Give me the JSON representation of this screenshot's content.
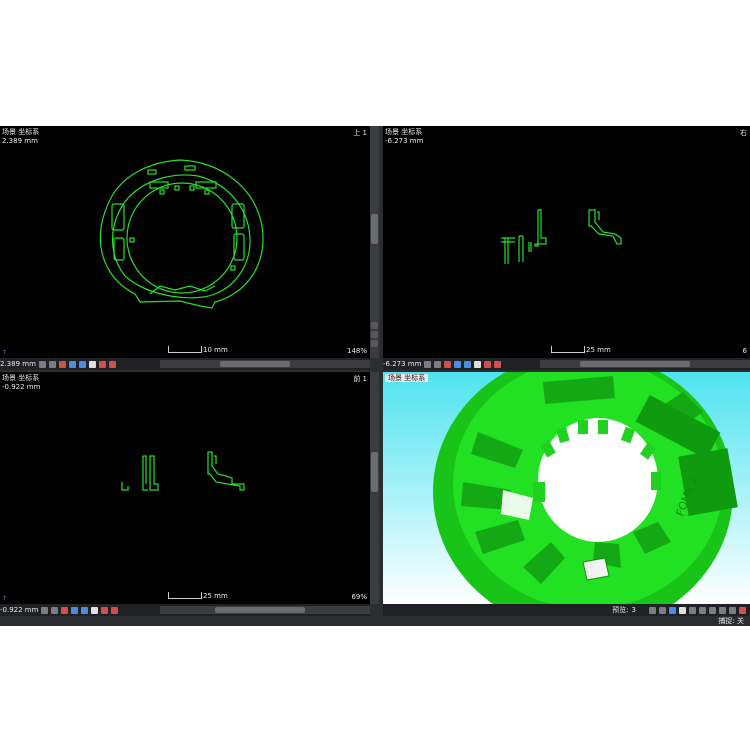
{
  "viewports": {
    "top": {
      "title": "场景 坐标系",
      "value": "2.389 mm",
      "corner": "上 1",
      "scale": "10 mm",
      "zoom": "148%",
      "status_value": "2.389 mm"
    },
    "right": {
      "title": "场景 坐标系",
      "value": "-6.273 mm",
      "corner": "右",
      "scale": "25 mm",
      "zoom": "6",
      "status_value": "-6.273 mm"
    },
    "front": {
      "title": "场景 坐标系",
      "value": "-0.922 mm",
      "corner": "前 1",
      "scale": "25 mm",
      "zoom": "69%",
      "status_value": "-0.922 mm"
    },
    "perspective": {
      "title": "场景 坐标系",
      "preview_label": "预览:",
      "preview_value": "3"
    }
  },
  "statusbar": {
    "capture": "捕捉: 关"
  },
  "model_text": "FOMx 2",
  "colors": {
    "outline": "#27e02a",
    "model": "#1ee01e",
    "background": "#000000",
    "sky": "#4fe3f0"
  }
}
